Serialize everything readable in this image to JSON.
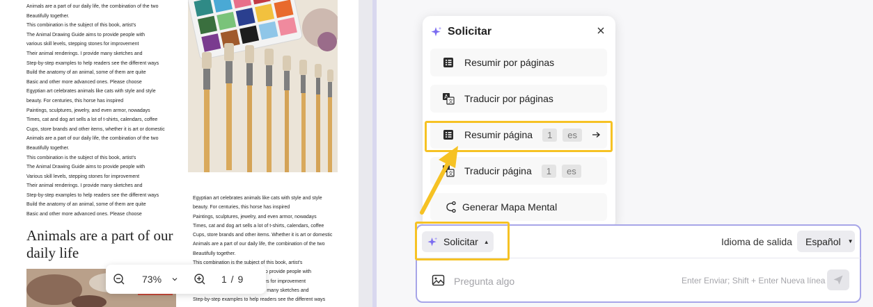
{
  "document": {
    "column1_lines": [
      "Animals are a part of our daily life, the combination of the two",
      "Beautifully together.",
      "This combination is the subject of this book, artist's",
      "The Animal Drawing Guide aims to provide people with",
      "various skill levels, stepping stones for improvement",
      "Their animal renderings. I provide many sketches and",
      "Step-by-step examples to help readers see the different ways",
      "Build the anatomy of an animal, some of them are quite",
      "Basic and other more advanced ones. Please choose",
      "Egyptian art celebrates animals like cats with style and style",
      "beauty. For centuries, this horse has inspired",
      "Paintings, sculptures, jewelry, and even armor, nowadays",
      "Times, cat and dog art sells a lot of t-shirts, calendars, coffee",
      "Cups, store brands and other items, whether it is art or domestic",
      "Animals are a part of our daily life, the combination of the two",
      "Beautifully together.",
      "This combination is the subject of this book, artist's",
      "The Animal Drawing Guide aims to provide people with",
      "Various skill levels, stepping stones for improvement",
      "Their animal renderings. I provide many sketches and",
      "Step-by-step examples to help readers see the different ways",
      "Build the anatomy of an animal, some of them are quite",
      "Basic and other more advanced ones. Please choose"
    ],
    "heading": "Animals are a part of our daily life",
    "column2_lines": [
      "Egyptian art celebrates animals like cats with style and style",
      "beauty. For centuries, this horse has inspired",
      "Paintings, sculptures, jewelry, and even armor, nowadays",
      "Times, cat and dog art sells a lot of t-shirts, calendars, coffee",
      "Cups, store brands and other items. Whether it is art or domestic",
      "Animals are a part of our daily life, the combination of the two",
      "Beautifully together.",
      "This combination is the subject of this book, artist's",
      "The Animal Drawing Guide aims to provide people with",
      "Various skill levels, stepping stones for improvement",
      "Their animal renderings. I provide many sketches and",
      "Step-by-step examples to help readers see the different ways"
    ]
  },
  "zoom_bar": {
    "zoom_value": "73%",
    "page_indicator": "1 / 9"
  },
  "popup": {
    "title": "Solicitar",
    "options": [
      {
        "label": "Resumir por páginas",
        "icon": "list-icon"
      },
      {
        "label": "Traducir por páginas",
        "icon": "translate-icon"
      },
      {
        "label": "Resumir página",
        "icon": "list-icon",
        "page": "1",
        "lang": "es"
      },
      {
        "label": "Traducir página",
        "icon": "translate-icon",
        "page": "1",
        "lang": "es"
      },
      {
        "label": "Generar Mapa Mental",
        "icon": "mindmap-icon"
      }
    ]
  },
  "input_panel": {
    "solicitar_label": "Solicitar",
    "output_language_label": "Idioma de salida",
    "output_language_value": "Español",
    "prompt_placeholder": "Pregunta algo",
    "hint": "Enter Enviar; Shift + Enter Nueva línea"
  },
  "colors": {
    "highlight": "#f6c224",
    "accent": "#a7a5e8",
    "sparkle": "#7b6cf0"
  }
}
